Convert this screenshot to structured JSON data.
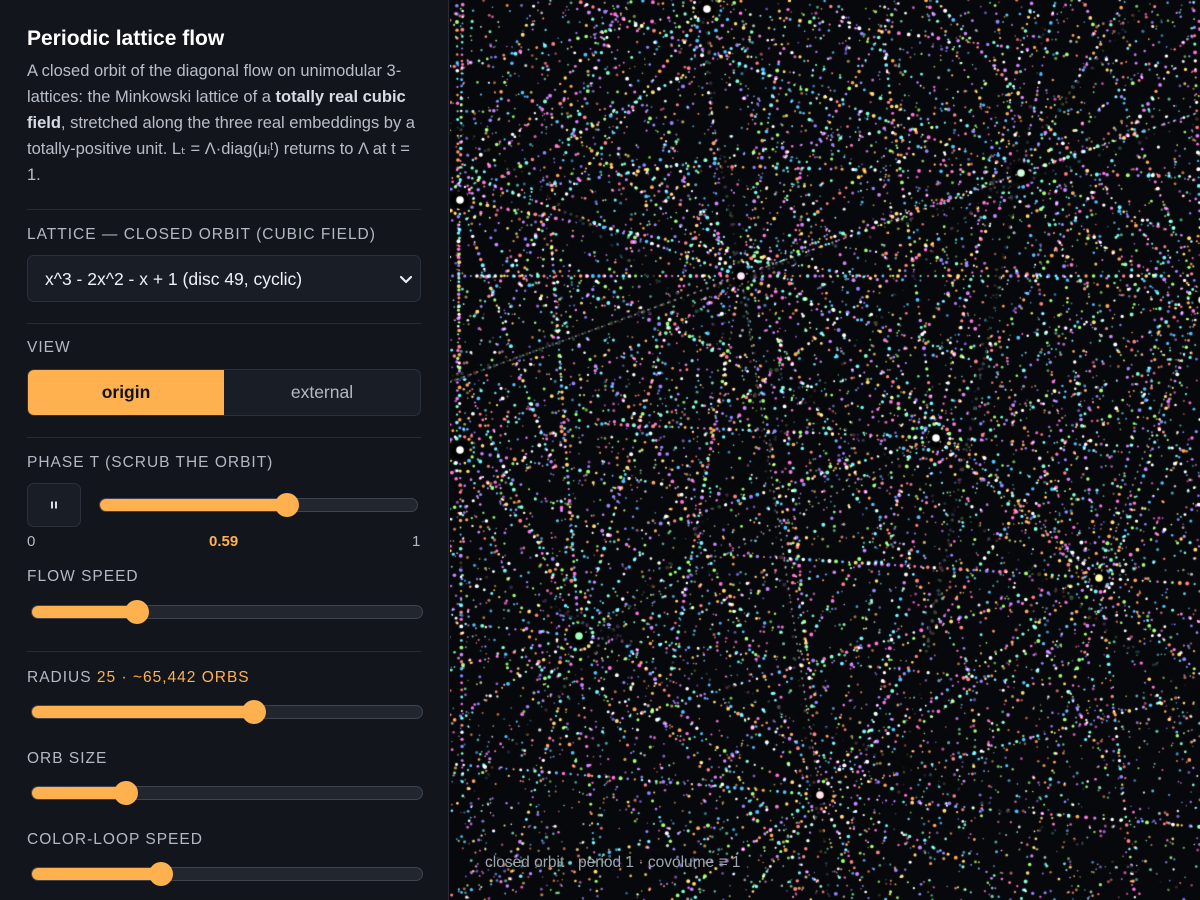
{
  "panel": {
    "title": "Periodic lattice flow",
    "description": {
      "part1": "A closed orbit of the diagonal flow on unimodular 3-lattices: the Minkowski lattice of a ",
      "bold": "totally real cubic field",
      "part2": ", stretched along the three real embeddings by a totally-positive unit. Lₜ = Λ·diag(μᵢᵗ) returns to Λ at t = 1."
    },
    "lattice": {
      "label": "LATTICE — CLOSED ORBIT (CUBIC FIELD)",
      "selected": "x^3 - 2x^2 - x + 1 (disc 49, cyclic)"
    },
    "view": {
      "label": "VIEW",
      "options": [
        "origin",
        "external"
      ],
      "active": "origin"
    },
    "phase": {
      "label": "PHASE T (SCRUB THE ORBIT)",
      "min_label": "0",
      "max_label": "1",
      "value": 0.59,
      "value_label": "0.59",
      "play_state": "playing"
    },
    "flow_speed": {
      "label": "FLOW SPEED",
      "value": 0.27
    },
    "radius": {
      "label": "RADIUS",
      "value_text": "25",
      "sep": "·",
      "orbs_text": "~65,442 ORBS",
      "value": 0.57
    },
    "orb_size": {
      "label": "ORB SIZE",
      "value": 0.24
    },
    "color_loop": {
      "label": "COLOR-LOOP SPEED",
      "value": 0.33
    }
  },
  "colors": {
    "accent": "#ffb04f",
    "panel_bg": "#12151c",
    "canvas_bg": "#07080b"
  },
  "canvas": {
    "status": "closed orbit · period 1 · covolume ≡ 1"
  }
}
